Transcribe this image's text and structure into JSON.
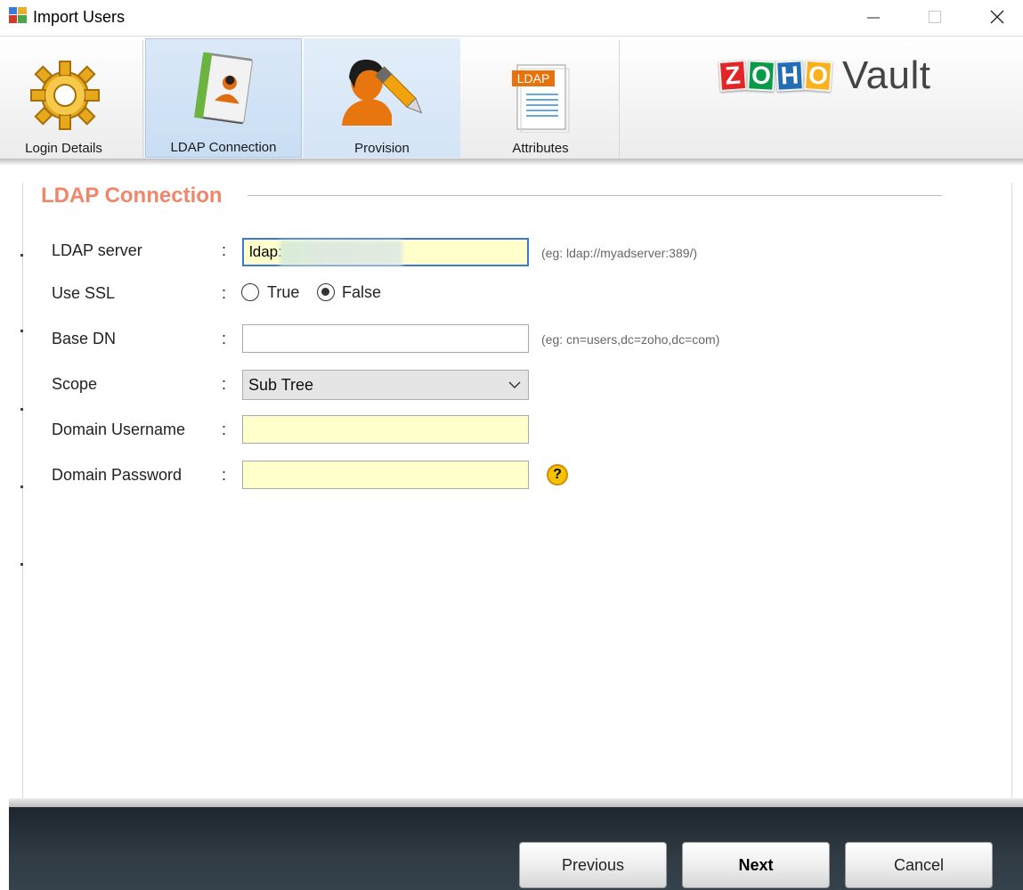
{
  "window": {
    "title": "Import Users",
    "controls": {
      "minimize": "minimize-icon",
      "maximize": "maximize-icon",
      "close": "close-icon"
    }
  },
  "toolbar": {
    "tabs": [
      {
        "label": "Login Details",
        "icon": "gear-icon",
        "state": "normal"
      },
      {
        "label": "LDAP Connection",
        "icon": "address-book-icon",
        "state": "selected"
      },
      {
        "label": "Provision",
        "icon": "user-edit-icon",
        "state": "hover"
      },
      {
        "label": "Attributes",
        "icon": "ldap-document-icon",
        "state": "normal",
        "badge": "LDAP"
      }
    ]
  },
  "logo": {
    "letters": [
      "Z",
      "O",
      "H",
      "O"
    ],
    "letter_colors": [
      "#e42527",
      "#089949",
      "#226db4",
      "#f9b21d"
    ],
    "product": "Vault"
  },
  "section": {
    "title": "LDAP Connection"
  },
  "form": {
    "colon": ":",
    "ldap_server": {
      "label": "LDAP server",
      "value": "ldap:",
      "hint": "(eg: ldap://myadserver:389/)"
    },
    "use_ssl": {
      "label": "Use SSL",
      "options": [
        "True",
        "False"
      ],
      "selected": "False"
    },
    "base_dn": {
      "label": "Base DN",
      "value": "",
      "hint": "(eg: cn=users,dc=zoho,dc=com)"
    },
    "scope": {
      "label": "Scope",
      "selected": "Sub Tree"
    },
    "domain_username": {
      "label": "Domain Username",
      "value": ""
    },
    "domain_password": {
      "label": "Domain Password",
      "value": "",
      "help": "?"
    }
  },
  "footer": {
    "previous": "Previous",
    "next": "Next",
    "cancel": "Cancel"
  },
  "colors": {
    "section_title": "#f0866a",
    "input_required_bg": "#ffffcc",
    "footer_bg": "#2b353d",
    "tab_selected_bg": "#c9ddf3"
  }
}
